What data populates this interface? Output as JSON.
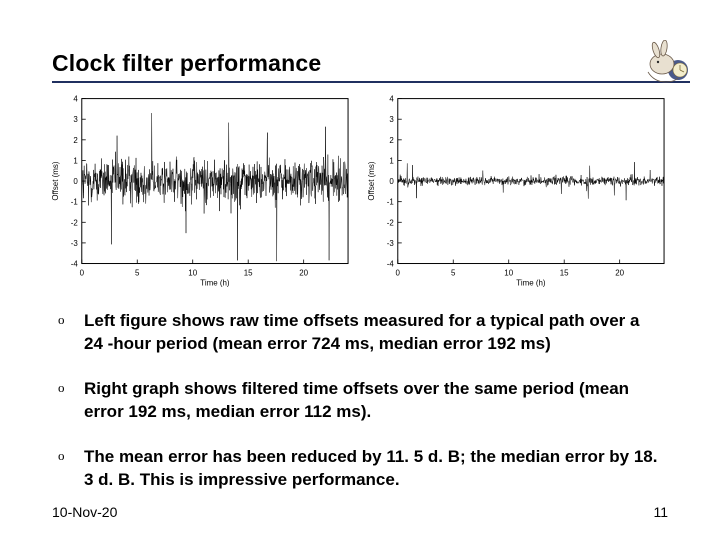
{
  "title": "Clock filter performance",
  "bullets": [
    {
      "mark": "o",
      "text": "Left figure shows raw time offsets measured for a typical path over a 24 -hour period (mean error 724 ms, median error 192 ms)"
    },
    {
      "mark": "o",
      "text": "Right graph shows filtered time offsets over the same period (mean error 192 ms, median error 112 ms)."
    },
    {
      "mark": "o",
      "text": "The mean error has been reduced by 11. 5 d. B; the median error by 18. 3 d. B. This is impressive performance."
    }
  ],
  "footer": {
    "date": "10-Nov-20",
    "page": "11"
  },
  "chart_data": [
    {
      "type": "line",
      "title": "",
      "xlabel": "Time (h)",
      "ylabel": "Offset (ms)",
      "xlim": [
        0,
        24
      ],
      "ylim": [
        -4,
        4
      ],
      "xticks": [
        0,
        5,
        10,
        15,
        20
      ],
      "yticks": [
        -4,
        -3,
        -2,
        -1,
        0,
        1,
        2,
        3,
        4
      ],
      "description": "Raw time offsets, dense noisy signal centered on 0 with frequent spikes reaching ±3 to ±4 ms",
      "amplitude_typical": 1.5,
      "amplitude_max": 4.0
    },
    {
      "type": "line",
      "title": "",
      "xlabel": "Time (h)",
      "ylabel": "Offset (ms)",
      "xlim": [
        0,
        24
      ],
      "ylim": [
        -4,
        4
      ],
      "xticks": [
        0,
        5,
        10,
        15,
        20
      ],
      "yticks": [
        -4,
        -3,
        -2,
        -1,
        0,
        1,
        2,
        3,
        4
      ],
      "description": "Filtered time offsets, much smaller noise mostly within ±0.5 ms, occasional spikes to ±1 ms",
      "amplitude_typical": 0.3,
      "amplitude_max": 1.0
    }
  ]
}
